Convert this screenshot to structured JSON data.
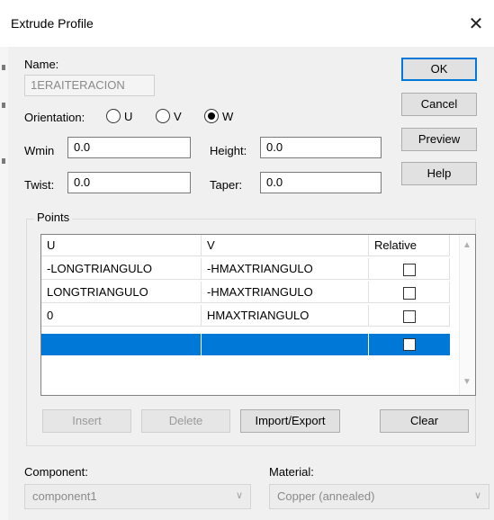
{
  "window": {
    "title": "Extrude Profile",
    "close_glyph": "✕"
  },
  "name": {
    "label": "Name:",
    "value": "1ERAITERACION"
  },
  "orientation": {
    "label": "Orientation:",
    "options": [
      {
        "label": "U",
        "checked": false
      },
      {
        "label": "V",
        "checked": false
      },
      {
        "label": "W",
        "checked": true
      }
    ]
  },
  "fields": {
    "wmin": {
      "label": "Wmin",
      "value": "0.0"
    },
    "height": {
      "label": "Height:",
      "value": "0.0"
    },
    "twist": {
      "label": "Twist:",
      "value": "0.0"
    },
    "taper": {
      "label": "Taper:",
      "value": "0.0"
    }
  },
  "buttons": {
    "ok": "OK",
    "cancel": "Cancel",
    "preview": "Preview",
    "help": "Help"
  },
  "points": {
    "group_label": "Points",
    "columns": [
      "U",
      "V",
      "Relative"
    ],
    "rows": [
      {
        "u": "-LONGTRIANGULO",
        "v": "-HMAXTRIANGULO",
        "relative": false
      },
      {
        "u": "LONGTRIANGULO",
        "v": "-HMAXTRIANGULO",
        "relative": false
      },
      {
        "u": "0",
        "v": "HMAXTRIANGULO",
        "relative": false
      },
      {
        "u": "",
        "v": "",
        "relative": false,
        "selected": true
      }
    ],
    "actions": {
      "insert": "Insert",
      "delete": "Delete",
      "import_export": "Import/Export",
      "clear": "Clear"
    }
  },
  "component": {
    "label": "Component:",
    "value": "component1"
  },
  "material": {
    "label": "Material:",
    "value": "Copper (annealed)"
  },
  "colors": {
    "selection": "#0078d7",
    "dialog_bg": "#f0f0f0",
    "default_button_border": "#0078d7"
  }
}
